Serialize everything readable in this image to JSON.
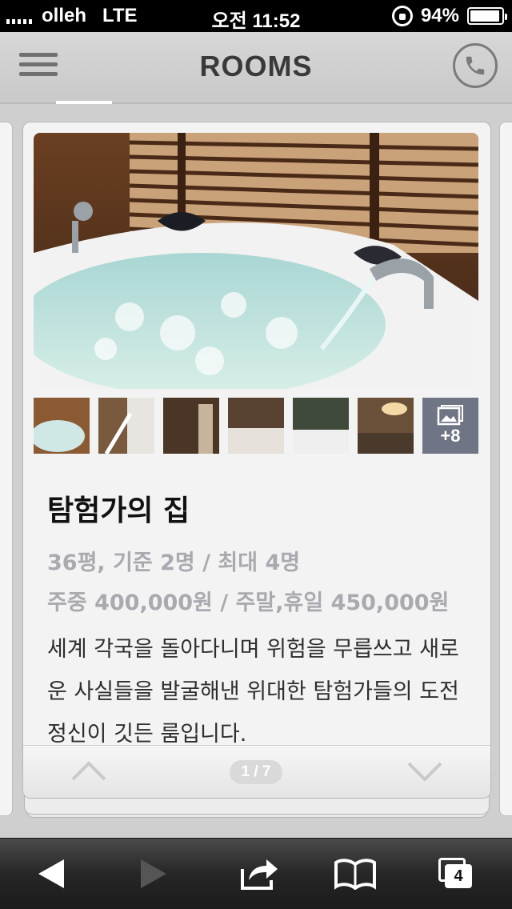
{
  "status_bar": {
    "carrier": "olleh",
    "network": "LTE",
    "time": "오전 11:52",
    "battery": "94%",
    "battery_level": 0.94
  },
  "header": {
    "title": "ROOMS",
    "menu_icon": "hamburger-menu-icon",
    "phone_icon": "phone-icon"
  },
  "room": {
    "name": "탐험가의 집",
    "size_capacity": "36평, 기준 2명 / 최대 4명",
    "price": "주중 400,000원 / 주말,휴일 450,000원",
    "description": "세계 각국을 돌아다니며 위험을 무릅쓰고 새로운 사실들을 발굴해낸 위대한 탐험가들의 도전 정신이 깃든 룸입니다.",
    "more_photos": "+8",
    "pager": "1 / 7"
  },
  "toolbar": {
    "tab_count": "4"
  },
  "colors": {
    "more_tile": "#6f7584",
    "info_text": "#a9a9b0"
  }
}
